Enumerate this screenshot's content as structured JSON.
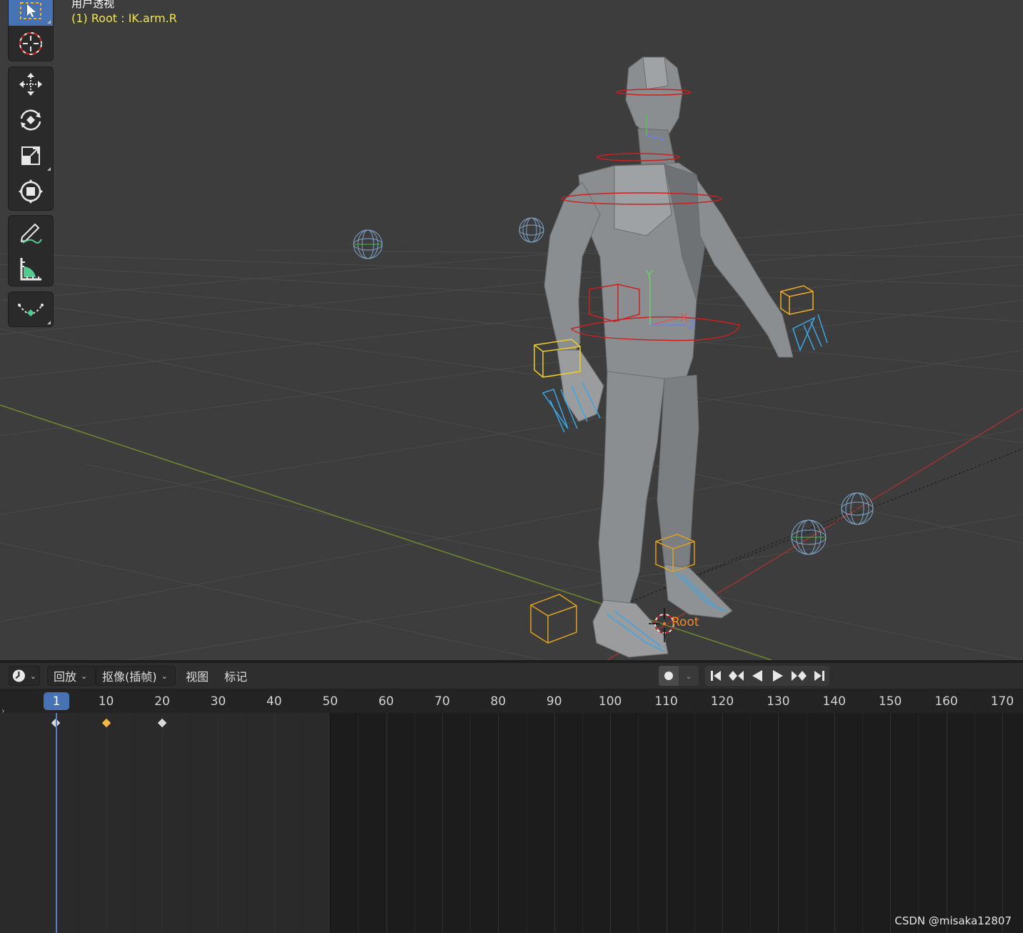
{
  "viewport": {
    "title": "用户透视",
    "active_object": "(1) Root : IK.arm.R",
    "root_label": "Root"
  },
  "toolbar": {
    "tools": [
      {
        "name": "select-box",
        "icon": "select-box-icon"
      },
      {
        "name": "cursor",
        "icon": "cursor-icon"
      },
      {
        "name": "move",
        "icon": "move-icon"
      },
      {
        "name": "rotate",
        "icon": "rotate-icon"
      },
      {
        "name": "scale",
        "icon": "scale-icon"
      },
      {
        "name": "transform",
        "icon": "transform-icon"
      },
      {
        "name": "annotate",
        "icon": "annotate-icon"
      },
      {
        "name": "measure",
        "icon": "measure-icon"
      },
      {
        "name": "pose-breakdown",
        "icon": "pose-breakdown-icon"
      }
    ]
  },
  "timeline": {
    "editor_icon": "clock-icon",
    "menus": {
      "playback": "回放",
      "keying": "抠像(插帧)",
      "view": "视图",
      "marker": "标记"
    },
    "record_icon": "record-icon",
    "playback_icons": [
      "jump-start-icon",
      "prev-keyframe-icon",
      "play-reverse-icon",
      "play-icon",
      "next-keyframe-icon",
      "jump-end-icon"
    ],
    "current_frame": "1",
    "frame_range_end": 50,
    "ruler_labels": [
      "10",
      "20",
      "30",
      "40",
      "50",
      "60",
      "70",
      "80",
      "90",
      "100",
      "110",
      "120",
      "130",
      "140",
      "150",
      "160",
      "170"
    ],
    "keyframes": [
      {
        "frame": 1,
        "selected": false,
        "color": "#d8d8d8"
      },
      {
        "frame": 10,
        "selected": true,
        "color": "#f5b93a"
      },
      {
        "frame": 20,
        "selected": false,
        "color": "#d8d8d8"
      }
    ]
  },
  "watermark": "CSDN @misaka12807",
  "colors": {
    "accent": "#4772b3",
    "header_text_yellow": "#f1e64a",
    "root_label": "#f08a24"
  }
}
